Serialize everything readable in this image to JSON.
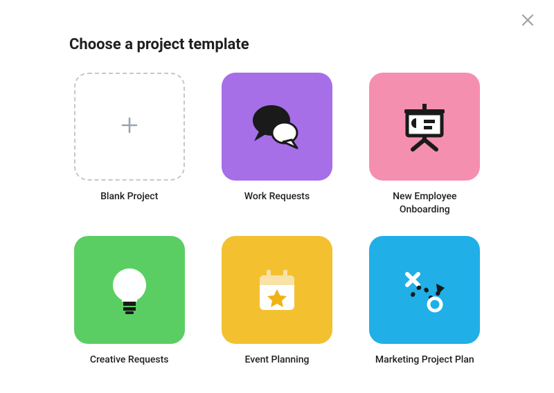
{
  "header": {
    "title": "Choose a project template"
  },
  "templates": [
    {
      "label": "Blank Project"
    },
    {
      "label": "Work Requests"
    },
    {
      "label": "New Employee Onboarding"
    },
    {
      "label": "Creative Requests"
    },
    {
      "label": "Event Planning"
    },
    {
      "label": "Marketing Project Plan"
    }
  ],
  "colors": {
    "purple": "#a66ee7",
    "pink": "#f48fb0",
    "green": "#5bce63",
    "yellow": "#f3c130",
    "blue": "#20afe6"
  }
}
